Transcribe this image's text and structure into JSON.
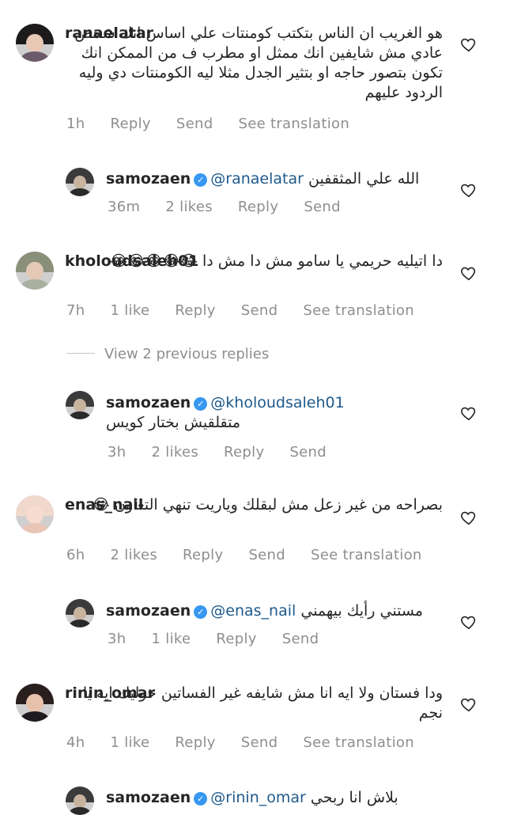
{
  "comments": [
    {
      "username": "ranaelatar",
      "text": "هو الغريب ان الناس بتكتب كومنتات علي اساس انك شخص عادي مش شايفين انك ممثل او مطرب ف من الممكن انك تكون بتصور حاجه او بتثير الجدل مثلا ليه الكومنتات دي وليه الردود عليهم",
      "time": "1h",
      "likes": "",
      "reply": "Reply",
      "send": "Send",
      "translation": "See translation"
    },
    {
      "username": "samozaen",
      "verified": true,
      "mention": "@ranaelatar",
      "text": "الله علي المثقفين",
      "time": "36m",
      "likes": "2 likes",
      "reply": "Reply",
      "send": "Send"
    },
    {
      "username": "kholoudsaleh01",
      "text": "دا اتيليه حريمي يا سامو مش دا مش دا 😂😂😂😂😂",
      "time": "7h",
      "likes": "1 like",
      "reply": "Reply",
      "send": "Send",
      "translation": "See translation"
    },
    {
      "username": "samozaen",
      "verified": true,
      "mention": "@kholoudsaleh01",
      "text": "متقلقيش بختار كويس",
      "time": "3h",
      "likes": "2 likes",
      "reply": "Reply",
      "send": "Send"
    },
    {
      "username": "enas_nail",
      "text": "بصراحه من غير زعل مش لبقلك وياريت تنهي التعاون 😂",
      "time": "6h",
      "likes": "2 likes",
      "reply": "Reply",
      "send": "Send",
      "translation": "See translation"
    },
    {
      "username": "samozaen",
      "verified": true,
      "mention": "@enas_nail",
      "text": "مستني رأيك بيهمني",
      "time": "3h",
      "likes": "1 like",
      "reply": "Reply",
      "send": "Send"
    },
    {
      "username": "rinin_omar",
      "text": "ودا فستان ولا ايه انا مش شايفه غير الفساتين حوليك ايه يا نجم",
      "time": "4h",
      "likes": "1 like",
      "reply": "Reply",
      "send": "Send",
      "translation": "See translation"
    },
    {
      "username": "samozaen",
      "verified": true,
      "mention": "@rinin_omar",
      "text": "بلاش انا ربحي"
    }
  ],
  "view_previous": "View 2 previous replies",
  "icons": {
    "heart": "heart-outline-icon",
    "verified": "verified-badge-icon"
  },
  "colors": {
    "muted": "#8e8e8e",
    "mention": "#1e5a8c",
    "verified": "#3897f0"
  }
}
